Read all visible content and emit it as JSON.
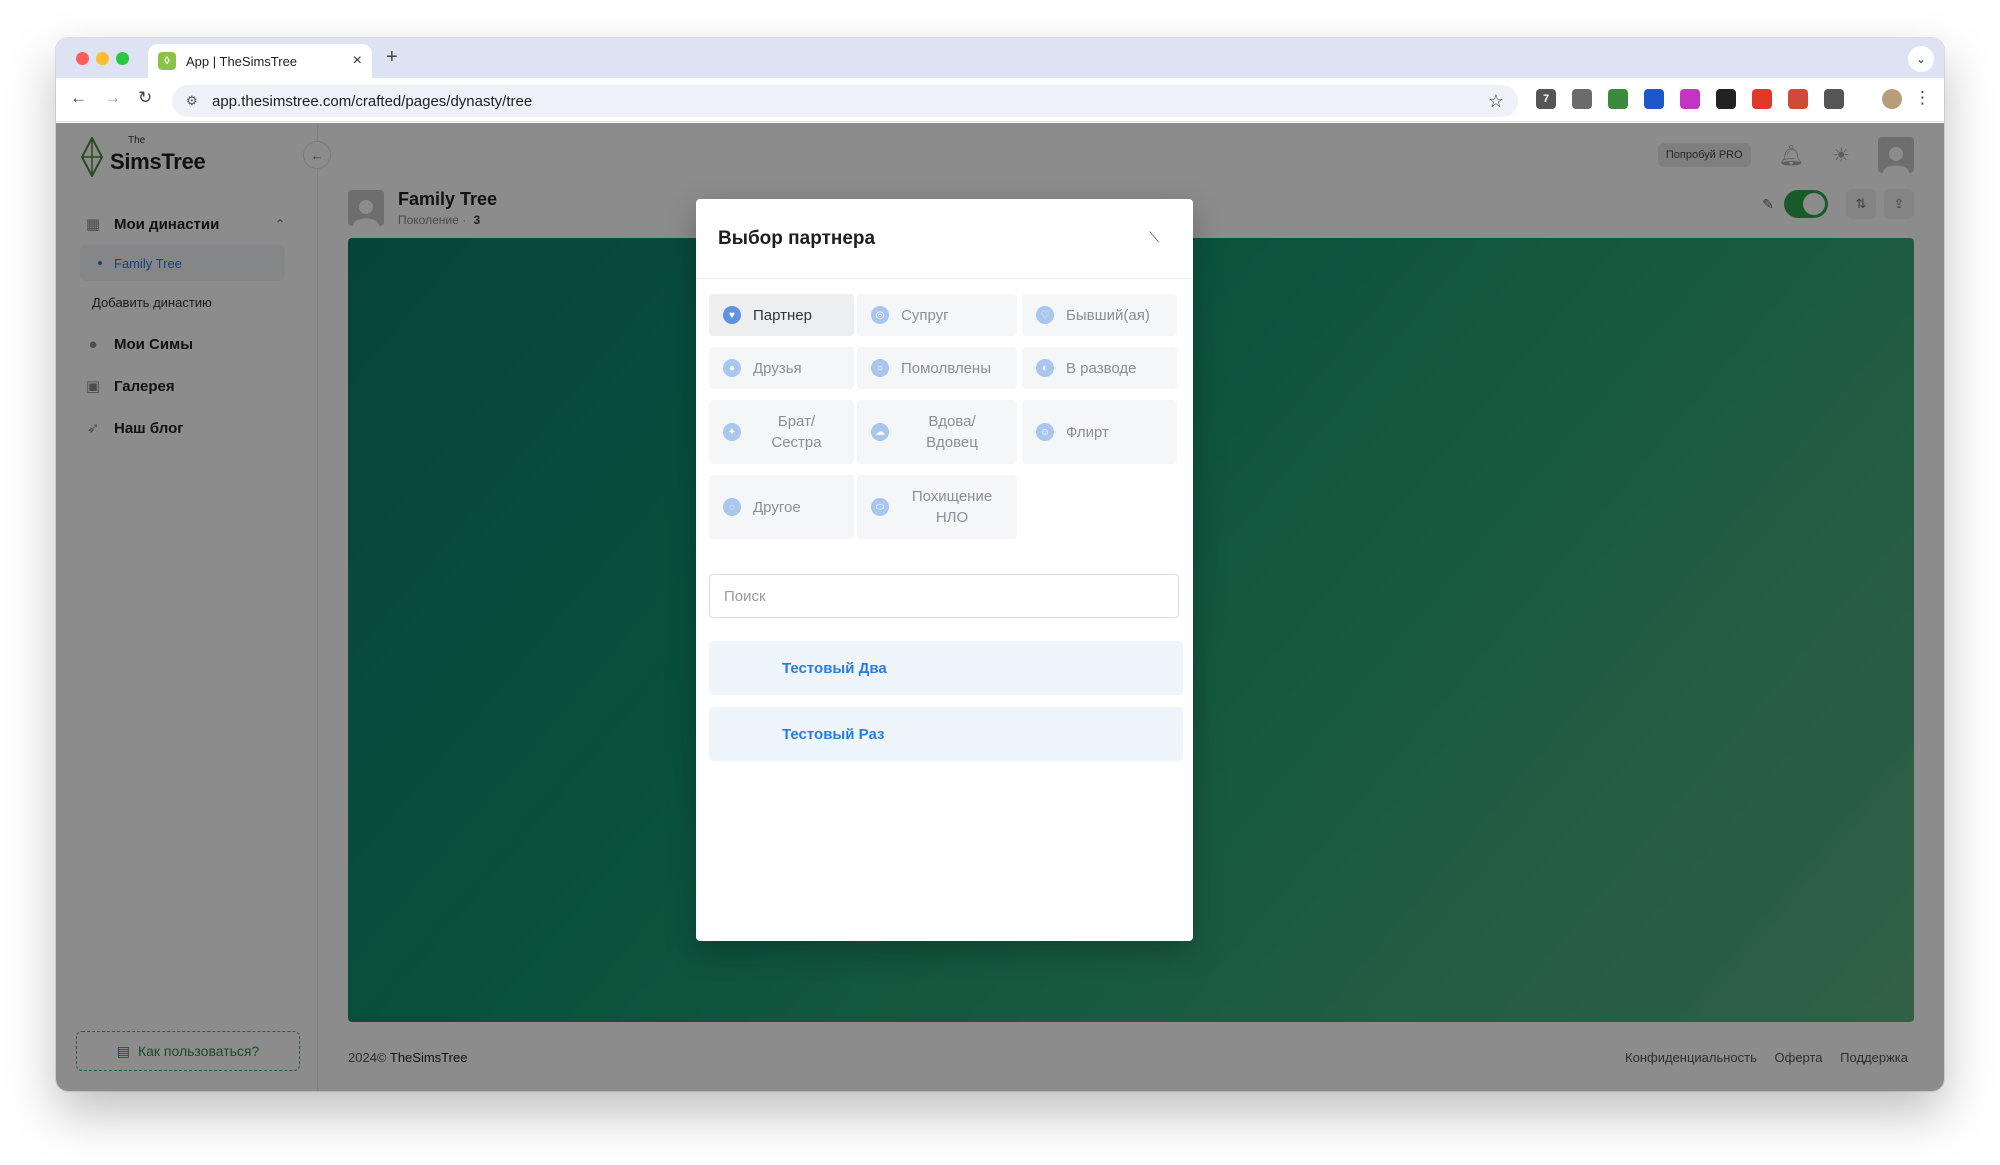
{
  "browser": {
    "tab_title": "App | TheSimsTree",
    "tab_favicon_glyph": "◊",
    "url": "app.thesimstree.com/crafted/pages/dynasty/tree",
    "extensions": [
      {
        "name": "gmail-extension",
        "badge": "7",
        "color": "#555555"
      },
      {
        "name": "diamond-extension",
        "color": "#6b6b6b"
      },
      {
        "name": "green-extension",
        "color": "#3c8a3c"
      },
      {
        "name": "blue-extension",
        "color": "#1e58c8"
      },
      {
        "name": "pink-extension",
        "color": "#c235c2"
      },
      {
        "name": "notion-extension",
        "color": "#222222"
      },
      {
        "name": "red-extension",
        "color": "#e0392a"
      },
      {
        "name": "cast-extension",
        "color": "#d04a3a"
      },
      {
        "name": "puzzle-extension",
        "color": "#555555"
      }
    ]
  },
  "sidebar": {
    "logo_the": "The",
    "logo_name": "SimsTree",
    "items": [
      {
        "label": "Мои династии",
        "icon": "grid-icon"
      },
      {
        "label": "Мои Симы",
        "icon": "users-icon"
      },
      {
        "label": "Галерея",
        "icon": "image-icon"
      },
      {
        "label": "Наш блог",
        "icon": "rocket-icon"
      }
    ],
    "sub_item": "Family Tree",
    "add_dynasty": "Добавить династию",
    "howto": "Как пользоваться?"
  },
  "topbar": {
    "pro_label": "Попробуй PRO"
  },
  "page": {
    "title": "Family Tree",
    "generation_label": "Поколение",
    "generation_value": "3"
  },
  "footer": {
    "copyright_prefix": "2024©",
    "brand": "TheSimsTree",
    "links": [
      "Конфиденциальность",
      "Оферта",
      "Поддержка"
    ]
  },
  "modal": {
    "title": "Выбор партнера",
    "relations": [
      {
        "label": "Партнер",
        "icon": "heart-icon",
        "active": true
      },
      {
        "label": "Супруг",
        "icon": "rings-icon",
        "active": false
      },
      {
        "label": "Бывший(ая)",
        "icon": "broken-heart-icon",
        "active": false
      },
      {
        "label": "Друзья",
        "icon": "friends-icon",
        "active": false
      },
      {
        "label": "Помолвлены",
        "icon": "ring-icon",
        "active": false
      },
      {
        "label": "В разводе",
        "icon": "divorce-icon",
        "active": false
      },
      {
        "label": "Брат/ Сестра",
        "icon": "siblings-icon",
        "active": false
      },
      {
        "label": "Вдова/ Вдовец",
        "icon": "widow-icon",
        "active": false
      },
      {
        "label": "Флирт",
        "icon": "flirt-icon",
        "active": false
      },
      {
        "label": "Другое",
        "icon": "other-icon",
        "active": false
      },
      {
        "label": "Похищение НЛО",
        "icon": "ufo-icon",
        "active": false
      }
    ],
    "search_placeholder": "Поиск",
    "results": [
      "Тестовый Два",
      "Тестовый Раз"
    ]
  },
  "colors": {
    "accent": "#2a7be4",
    "toggle_on": "#2ea44f",
    "howto_border": "#4caf50"
  }
}
